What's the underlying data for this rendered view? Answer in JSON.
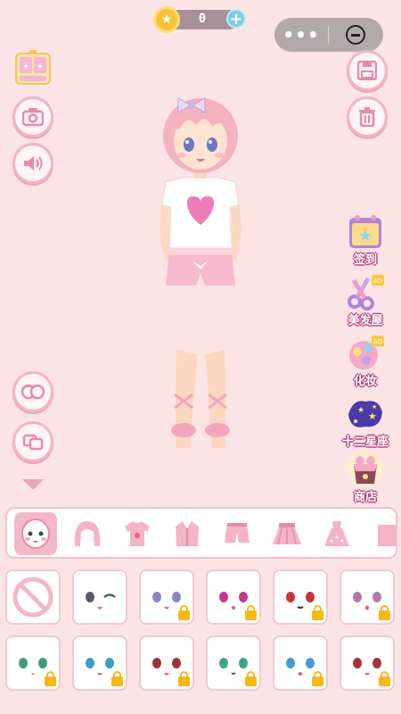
{
  "coins": {
    "count": "0"
  },
  "capsule": {
    "more_label": "•••"
  },
  "features": [
    {
      "label": "签到",
      "icon": "calendar-star-icon",
      "badge": ""
    },
    {
      "label": "美发屋",
      "icon": "scissors-icon",
      "badge": "AD"
    },
    {
      "label": "化妆",
      "icon": "makeup-palette-icon",
      "badge": "AD"
    },
    {
      "label": "十二星座",
      "icon": "constellation-icon",
      "badge": ""
    },
    {
      "label": "商店",
      "icon": "gift-bag-icon",
      "badge": ""
    }
  ],
  "left_tools": [
    "wardrobe-icon",
    "camera-icon",
    "sound-icon",
    "face-swap-icon",
    "rotate-icon",
    "collapse-arrow-icon"
  ],
  "right_tools": [
    "save-icon",
    "trash-icon"
  ],
  "categories": [
    {
      "name": "face",
      "icon": "face-icon",
      "active": true
    },
    {
      "name": "hair",
      "icon": "hair-icon",
      "active": false
    },
    {
      "name": "tops",
      "icon": "tshirt-icon",
      "active": false
    },
    {
      "name": "jacket",
      "icon": "jacket-icon",
      "active": false
    },
    {
      "name": "pants",
      "icon": "shorts-icon",
      "active": false
    },
    {
      "name": "skirt",
      "icon": "skirt-icon",
      "active": false
    },
    {
      "name": "dress",
      "icon": "dress-icon",
      "active": false
    },
    {
      "name": "more",
      "icon": "accessory-icon",
      "active": false
    }
  ],
  "items": [
    {
      "type": "none",
      "locked": false
    },
    {
      "eye": "#555a66",
      "locked": false,
      "wink": true
    },
    {
      "eye": "#8c84c8",
      "locked": true
    },
    {
      "eye": "#c23a8a",
      "locked": true
    },
    {
      "eye": "#c8323a",
      "locked": true
    },
    {
      "eye": "#b07aa8",
      "locked": true
    },
    {
      "eye": "#3f9a7a",
      "locked": true
    },
    {
      "eye": "#3aa0c6",
      "locked": true
    },
    {
      "eye": "#a0323a",
      "locked": true
    },
    {
      "eye": "#3aa58a",
      "locked": true
    },
    {
      "eye": "#4a9ad0",
      "locked": true
    },
    {
      "eye": "#a8323a",
      "locked": true
    }
  ]
}
